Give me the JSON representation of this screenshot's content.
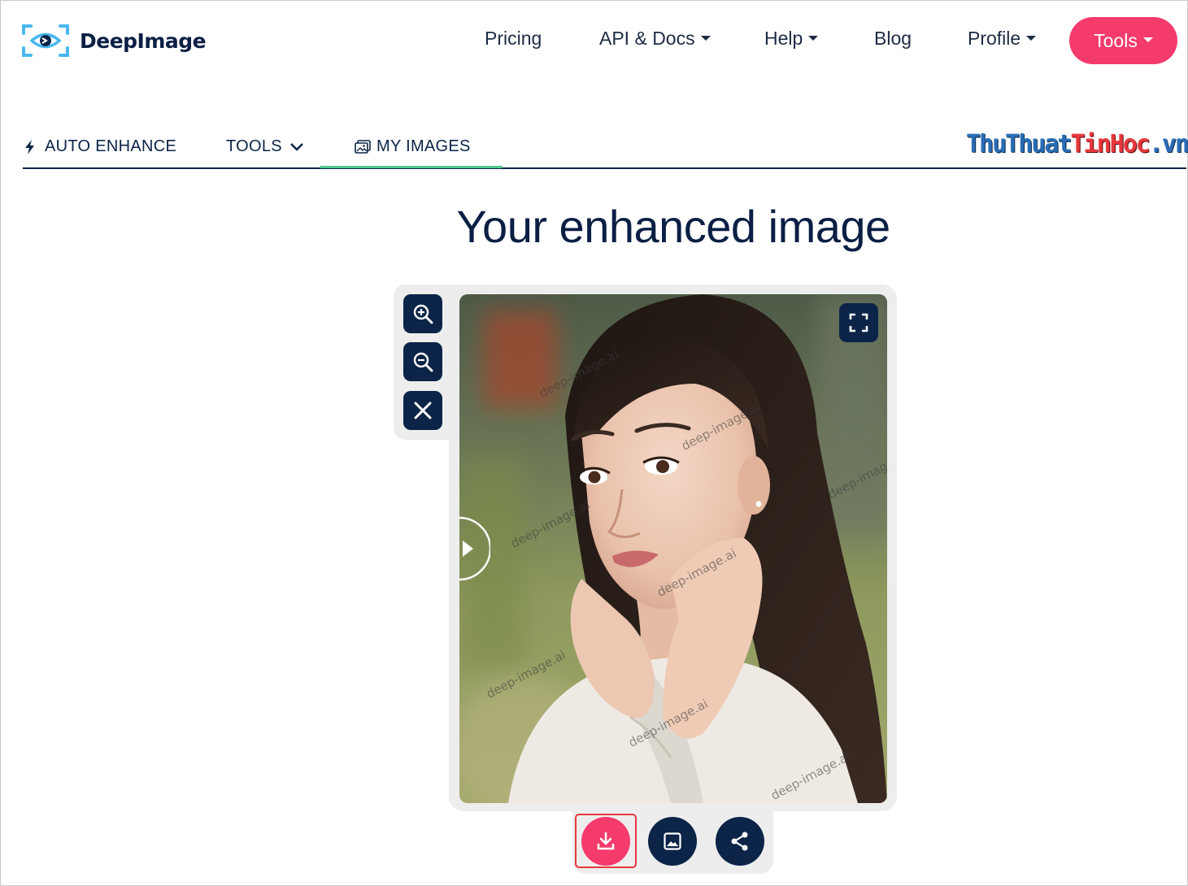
{
  "brand": {
    "name": "DeepImage",
    "logo_icon": "eye-logo-icon",
    "accent": "#f43b6b",
    "navy": "#0b2447"
  },
  "nav": {
    "items": [
      {
        "label": "Pricing",
        "dropdown": false
      },
      {
        "label": "API & Docs",
        "dropdown": true
      },
      {
        "label": "Help",
        "dropdown": true
      },
      {
        "label": "Blog",
        "dropdown": false
      },
      {
        "label": "Profile",
        "dropdown": true
      }
    ],
    "tools_label": "Tools"
  },
  "tabs": [
    {
      "label": "AUTO ENHANCE",
      "icon": "bolt-icon"
    },
    {
      "label": "TOOLS",
      "icon": "chevron-down-icon"
    },
    {
      "label": "MY IMAGES",
      "icon": "gallery-icon",
      "active": true
    }
  ],
  "watermark_site": {
    "part1": "ThuThuat",
    "part2": "TinHoc",
    "part3": ".vn"
  },
  "main": {
    "title": "Your enhanced image"
  },
  "viewer": {
    "controls": [
      "zoom-in-icon",
      "zoom-out-icon",
      "close-icon"
    ],
    "image_watermark": "deep-image.ai",
    "fullscreen_icon": "fullscreen-icon",
    "compare_handle_icon": "play-right-icon"
  },
  "actions": [
    {
      "name": "download",
      "icon": "download-icon"
    },
    {
      "name": "image",
      "icon": "image-icon"
    },
    {
      "name": "share",
      "icon": "share-icon"
    }
  ]
}
